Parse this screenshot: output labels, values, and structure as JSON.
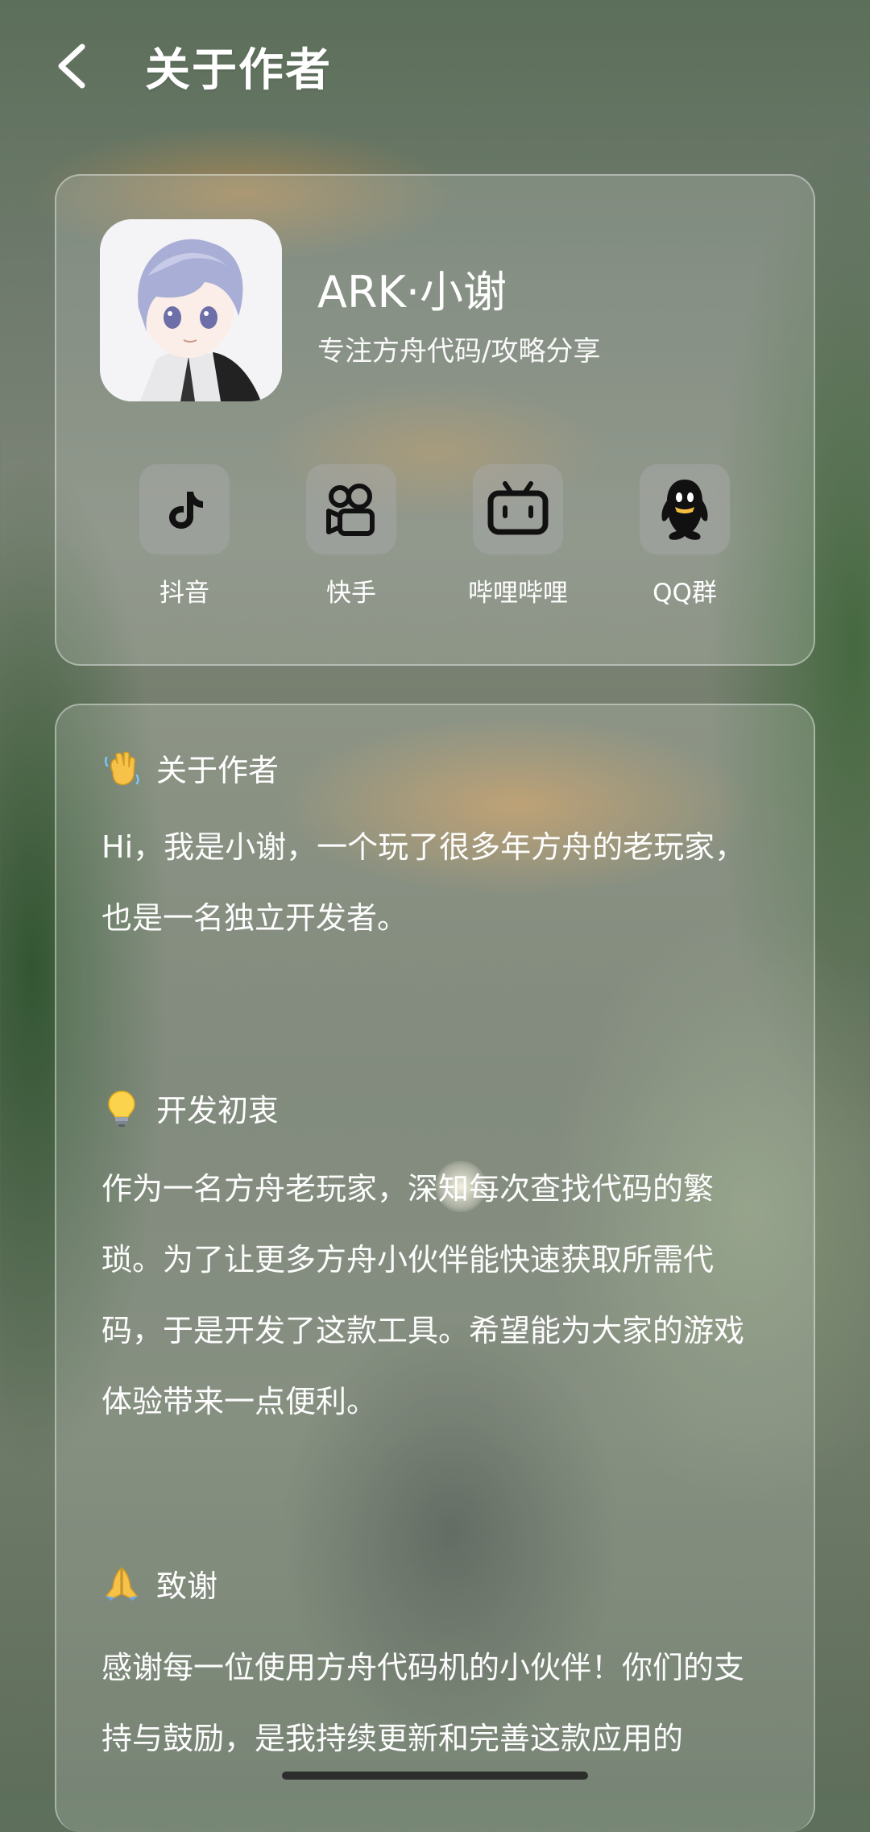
{
  "header": {
    "title": "关于作者"
  },
  "profile": {
    "name": "ARK·小谢",
    "tagline": "专注方舟代码/攻略分享",
    "socials": [
      {
        "label": "抖音",
        "icon": "douyin-icon"
      },
      {
        "label": "快手",
        "icon": "kuaishou-icon"
      },
      {
        "label": "哔哩哔哩",
        "icon": "bilibili-icon"
      },
      {
        "label": "QQ群",
        "icon": "qq-icon"
      }
    ]
  },
  "about": {
    "sections": [
      {
        "icon": "waving-hand-emoji",
        "heading": "关于作者",
        "text": "Hi，我是小谢，一个玩了很多年方舟的老玩家，也是一名独立开发者。"
      },
      {
        "icon": "light-bulb-emoji",
        "heading": "开发初衷",
        "text": "作为一名方舟老玩家，深知每次查找代码的繁琐。为了让更多方舟小伙伴能快速获取所需代码，于是开发了这款工具。希望能为大家的游戏体验带来一点便利。"
      },
      {
        "icon": "folded-hands-emoji",
        "heading": "致谢",
        "text": "感谢每一位使用方舟代码机的小伙伴！你们的支持与鼓励，是我持续更新和完善这款应用的"
      }
    ]
  }
}
